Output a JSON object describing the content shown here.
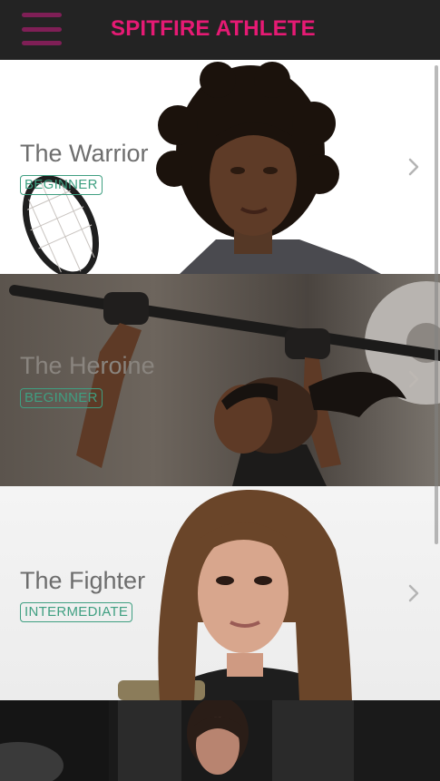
{
  "app": {
    "title": "SPITFIRE ATHLETE"
  },
  "menu": {
    "icon": "hamburger-menu-icon"
  },
  "programs": [
    {
      "title": "The Warrior",
      "level": "BEGINNER"
    },
    {
      "title": "The Heroine",
      "level": "BEGINNER"
    },
    {
      "title": "The Fighter",
      "level": "INTERMEDIATE"
    }
  ],
  "colors": {
    "brand": "#e61a74",
    "menu_icon": "#7f1f56",
    "topbar": "#232323",
    "badge": "#3f9f81"
  }
}
